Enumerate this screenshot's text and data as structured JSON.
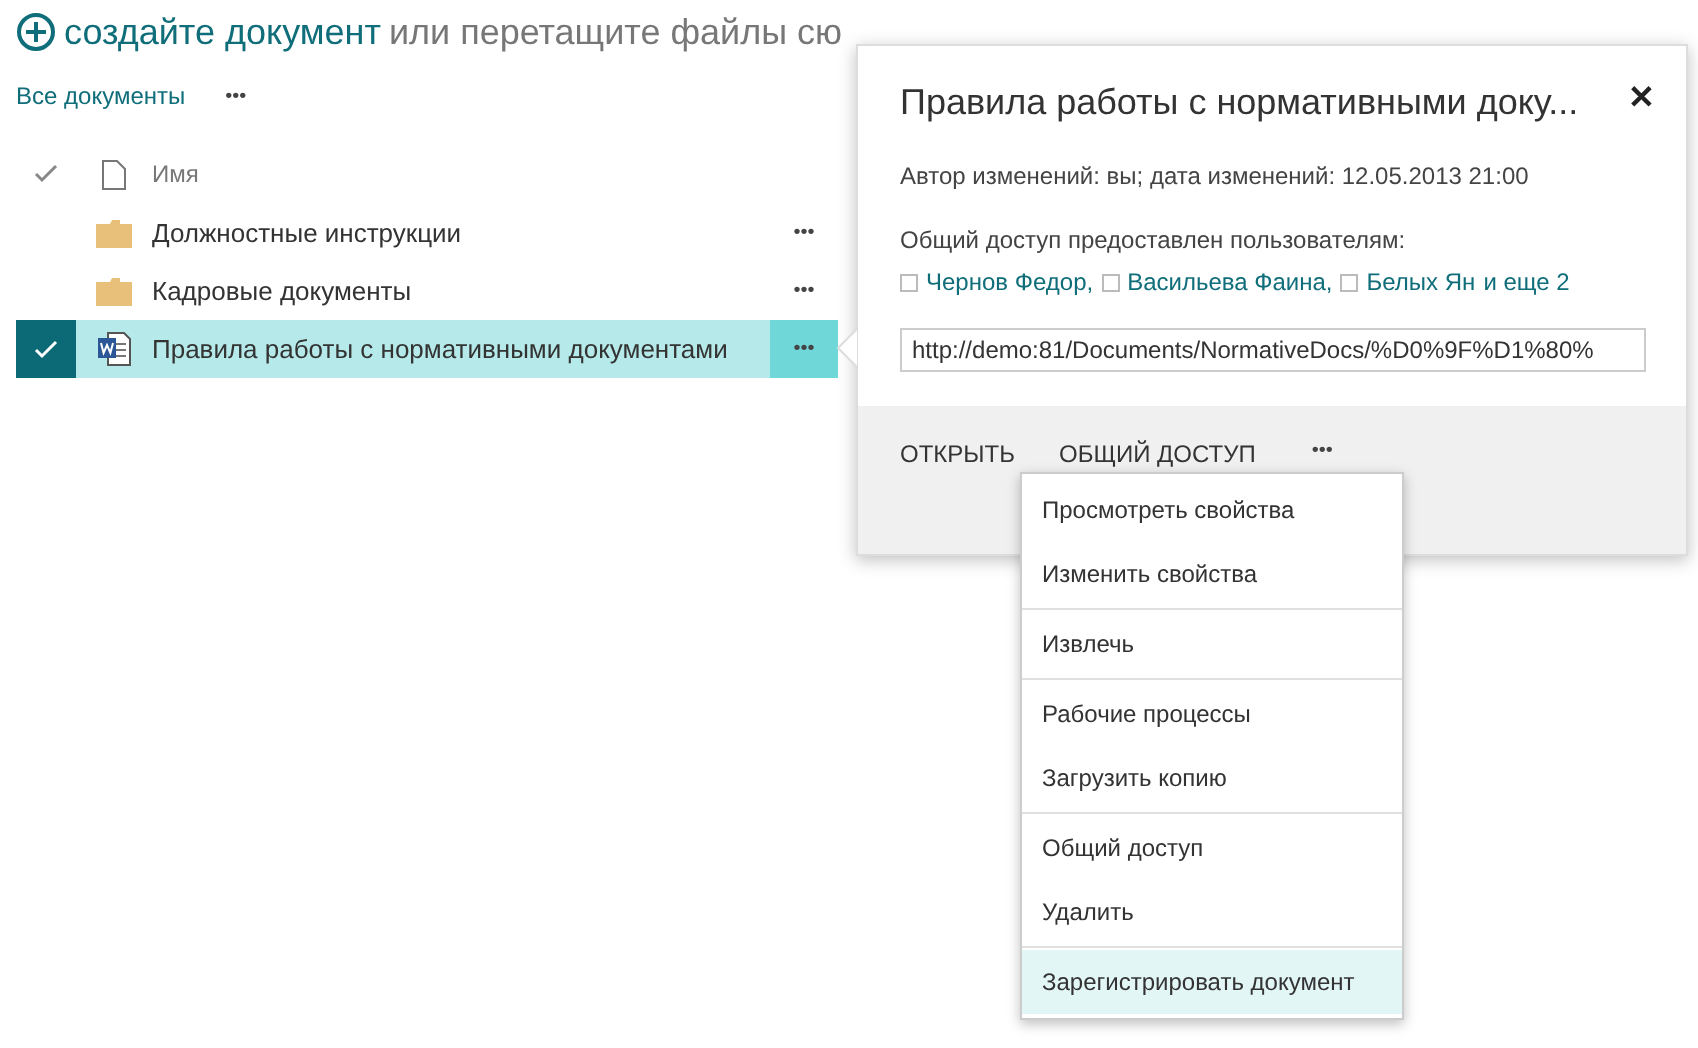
{
  "header": {
    "create_link": "создайте документ",
    "rest": "или перетащите файлы сю"
  },
  "views": {
    "current": "Все документы",
    "more": "•••"
  },
  "list": {
    "column_name": "Имя",
    "rows": [
      {
        "kind": "folder",
        "name": "Должностные инструкции",
        "more": "•••",
        "selected": false
      },
      {
        "kind": "folder",
        "name": "Кадровые документы",
        "more": "•••",
        "selected": false
      },
      {
        "kind": "word",
        "name": "Правила работы с нормативными документами",
        "more": "•••",
        "selected": true
      }
    ]
  },
  "callout": {
    "title": "Правила работы с нормативными доку...",
    "close": "✕",
    "modified": "Автор изменений: вы; дата изменений: 12.05.2013 21:00",
    "shared_label": "Общий доступ предоставлен пользователям:",
    "users": [
      "Чернов Федор,",
      "Васильева Фаина,",
      "Белых Ян"
    ],
    "more_users": "и еще 2",
    "url": "http://demo:81/Documents/NormativeDocs/%D0%9F%D1%80%",
    "actions": [
      "ОТКРЫТЬ",
      "ОБЩИЙ ДОСТУП"
    ],
    "more": "•••"
  },
  "menu": [
    [
      {
        "label": "Просмотреть свойства",
        "selected": false
      },
      {
        "label": "Изменить свойства",
        "selected": false
      }
    ],
    [
      {
        "label": "Извлечь",
        "selected": false
      }
    ],
    [
      {
        "label": "Рабочие процессы",
        "selected": false
      },
      {
        "label": "Загрузить копию",
        "selected": false
      }
    ],
    [
      {
        "label": "Общий доступ",
        "selected": false
      },
      {
        "label": "Удалить",
        "selected": false
      }
    ],
    [
      {
        "label": "Зарегистрировать документ",
        "selected": true
      }
    ]
  ]
}
